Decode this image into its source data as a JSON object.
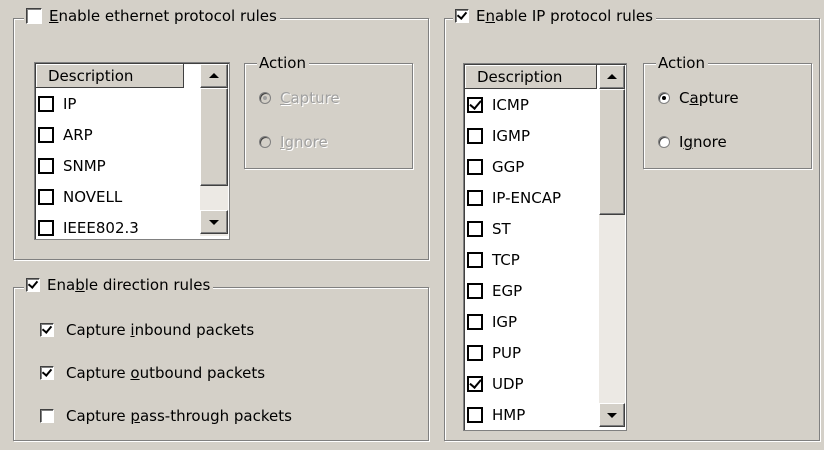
{
  "ethernet_group": {
    "label_pre": "",
    "label_u": "E",
    "label_post": "nable ethernet protocol rules",
    "checked": false,
    "list_header": "Description",
    "items": [
      {
        "label": "IP",
        "checked": false
      },
      {
        "label": "ARP",
        "checked": false
      },
      {
        "label": "SNMP",
        "checked": false
      },
      {
        "label": "NOVELL",
        "checked": false
      },
      {
        "label": "IEEE802.3",
        "checked": false
      }
    ],
    "action": {
      "title": "Action",
      "capture_u": "C",
      "capture_rest": "apture",
      "ignore_u": "I",
      "ignore_rest": "gnore",
      "selected": "capture",
      "disabled": true
    }
  },
  "ip_group": {
    "label_pre": "E",
    "label_u": "n",
    "label_post": "able IP protocol rules",
    "checked": true,
    "list_header": "Description",
    "items": [
      {
        "label": "ICMP",
        "checked": true
      },
      {
        "label": "IGMP",
        "checked": false
      },
      {
        "label": "GGP",
        "checked": false
      },
      {
        "label": "IP-ENCAP",
        "checked": false
      },
      {
        "label": "ST",
        "checked": false
      },
      {
        "label": "TCP",
        "checked": false
      },
      {
        "label": "EGP",
        "checked": false
      },
      {
        "label": "IGP",
        "checked": false
      },
      {
        "label": "PUP",
        "checked": false
      },
      {
        "label": "UDP",
        "checked": true
      },
      {
        "label": "HMP",
        "checked": false
      }
    ],
    "action": {
      "title": "Action",
      "capture_pre": "C",
      "capture_u": "a",
      "capture_rest": "pture",
      "ignore_pre": "I",
      "ignore_u": "g",
      "ignore_rest": "nore",
      "selected": "capture",
      "disabled": false
    }
  },
  "direction_group": {
    "label_pre": "Ena",
    "label_u": "b",
    "label_post": "le direction rules",
    "checked": true,
    "options": [
      {
        "pre": "Capture ",
        "u": "i",
        "post": "nbound packets",
        "checked": true
      },
      {
        "pre": "Capture ",
        "u": "o",
        "post": "utbound packets",
        "checked": true
      },
      {
        "pre": "Capture ",
        "u": "p",
        "post": "ass-through packets",
        "checked": false
      }
    ]
  }
}
